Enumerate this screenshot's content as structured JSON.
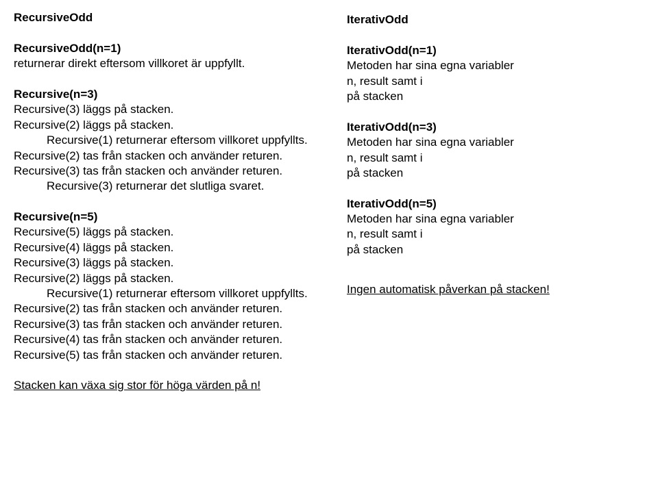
{
  "left": {
    "title": "RecursiveOdd",
    "sections": [
      {
        "heading": "RecursiveOdd(n=1)",
        "lines": [
          "returnerar direkt eftersom villkoret är uppfyllt."
        ]
      },
      {
        "heading": "Recursive(n=3)",
        "lines": [
          "Recursive(3) läggs på stacken.",
          "Recursive(2) läggs på stacken.",
          "Recursive(1) returnerar eftersom villkoret uppfyllts.",
          "Recursive(2) tas från stacken och använder returen.",
          "Recursive(3) tas från stacken och använder returen.",
          "Recursive(3) returnerar det slutliga svaret."
        ]
      },
      {
        "heading": "Recursive(n=5)",
        "lines": [
          "Recursive(5) läggs på stacken.",
          "Recursive(4) läggs på stacken.",
          "Recursive(3) läggs på stacken.",
          "Recursive(2) läggs på stacken.",
          "Recursive(1) returnerar eftersom villkoret uppfyllts.",
          "Recursive(2) tas från stacken och använder returen.",
          "Recursive(3) tas från stacken och använder returen.",
          "Recursive(4) tas från stacken och använder returen.",
          "Recursive(5) tas från stacken och använder returen."
        ]
      }
    ],
    "conclusion": "Stacken kan växa sig stor för höga värden på n!"
  },
  "right": {
    "title": "IterativOdd",
    "sections": [
      {
        "heading": "IterativOdd(n=1)",
        "lines": [
          "Metoden har sina egna variabler",
          "n, result samt  i",
          "på stacken"
        ]
      },
      {
        "heading": "IterativOdd(n=3)",
        "lines": [
          "Metoden har sina egna variabler",
          "n, result samt  i",
          "på stacken"
        ]
      },
      {
        "heading": "IterativOdd(n=5)",
        "lines": [
          "Metoden har sina egna variabler",
          "n, result samt  i",
          "på stacken"
        ]
      }
    ],
    "conclusion": "Ingen automatisk påverkan på stacken!"
  }
}
